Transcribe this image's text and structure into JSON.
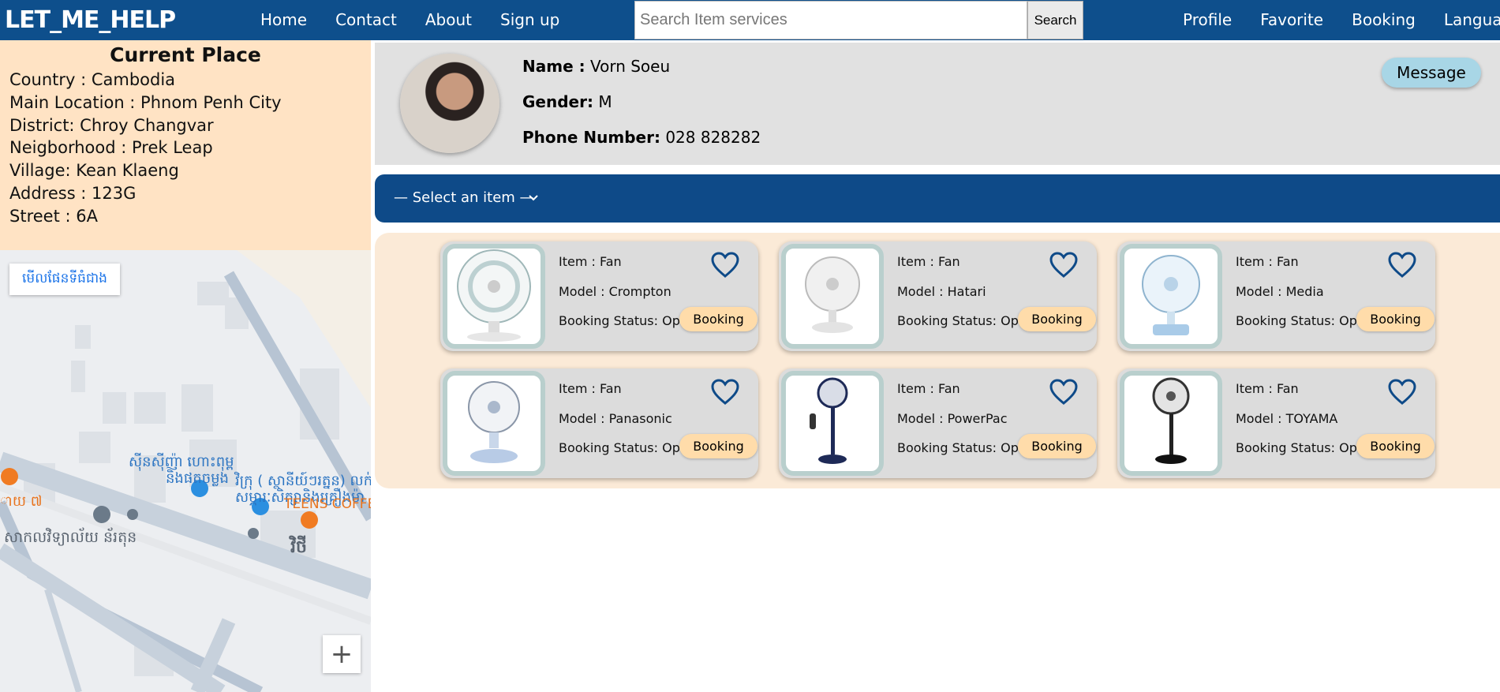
{
  "nav": {
    "brand": "LET_ME_HELP",
    "links": [
      "Home",
      "Contact",
      "About",
      "Sign up"
    ],
    "search_placeholder": "Search Item services",
    "search_button": "Search",
    "right_links": [
      "Profile",
      "Favorite",
      "Booking",
      "Language"
    ]
  },
  "place": {
    "title": "Current Place",
    "lines": [
      "Country : Cambodia",
      "Main Location : Phnom Penh City",
      "District: Chroy Changvar",
      "Neigborhood : Prek Leap",
      "Village: Kean Klaeng",
      "Address : 123G",
      "Street : 6A"
    ]
  },
  "map": {
    "view_larger": "មើលផែនទីធំជាង",
    "zoom_in": "+",
    "labels": [
      "ស៊ីនស៊ីញ៉ា ហោះពុម្ព",
      "និងផតចម្លង",
      "វិក្រុ ( ស្ថានីយ៍ៗរត្នន) លក់",
      "សម្ភារៈសិក្សានិងគ្រឿងម៉ា",
      "TEENS COFFE",
      "សាកលវិទ្យាល័យ ន័រតុន",
      "ាយ ៧",
      "វិថី"
    ]
  },
  "profile": {
    "name_label": "Name :",
    "name": "Vorn Soeu",
    "gender_label": "Gender:",
    "gender": "M",
    "phone_label": "Phone Number:",
    "phone": "028 828282",
    "message_button": "Message"
  },
  "select": {
    "label": "— Select an item —"
  },
  "items": [
    {
      "item": "Item : Fan",
      "model": "Model : Crompton",
      "status": "Booking Status: Open",
      "button": "Booking"
    },
    {
      "item": "Item : Fan",
      "model": "Model : Hatari",
      "status": "Booking Status: Open",
      "button": "Booking"
    },
    {
      "item": "Item : Fan",
      "model": "Model : Media",
      "status": "Booking Status: Open",
      "button": "Booking"
    },
    {
      "item": "Item : Fan",
      "model": "Model : Panasonic",
      "status": "Booking Status: Open",
      "button": "Booking"
    },
    {
      "item": "Item : Fan",
      "model": "Model : PowerPac",
      "status": "Booking Status: Open",
      "button": "Booking"
    },
    {
      "item": "Item : Fan",
      "model": "Model : TOYAMA",
      "status": "Booking Status: Open",
      "button": "Booking"
    }
  ],
  "colors": {
    "nav": "#0e4f8c",
    "select_bar": "#0e4a88",
    "place_bg": "#ffe3c4",
    "booking_btn": "#ffdcaa",
    "message_btn": "#a8d6e6",
    "heart": "#0e4a88"
  }
}
